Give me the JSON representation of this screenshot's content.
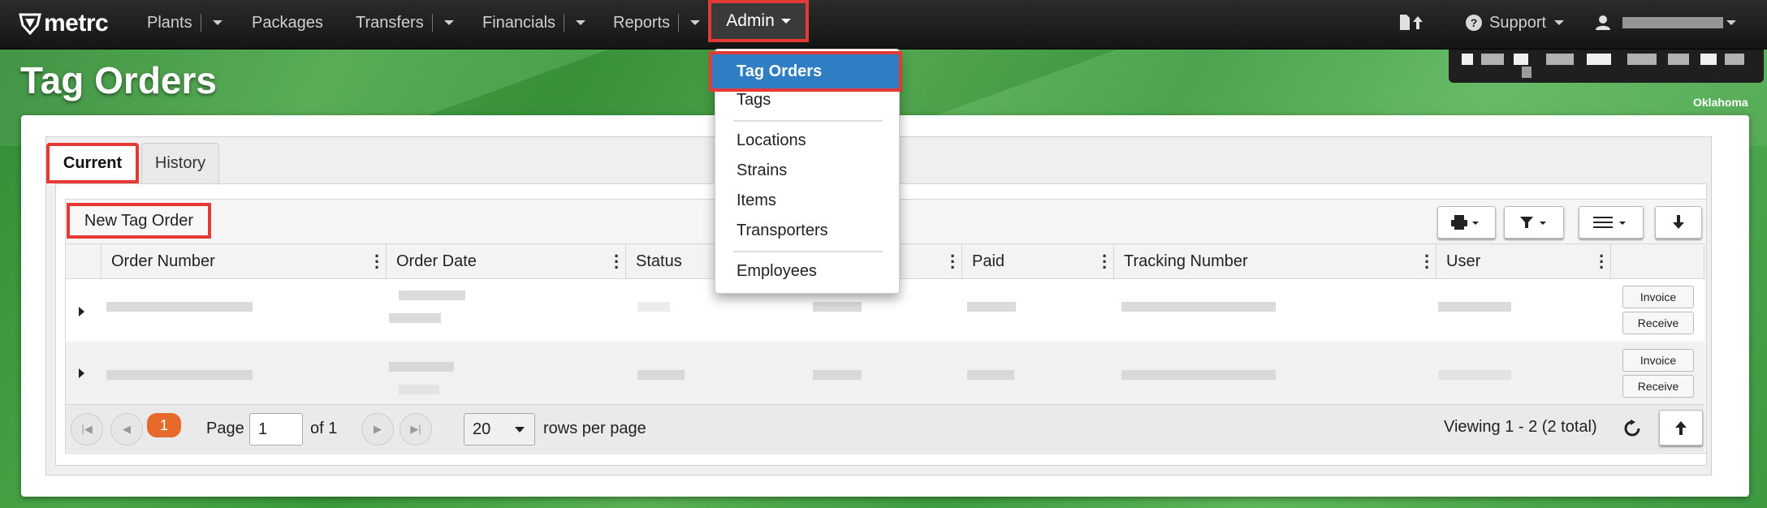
{
  "app": {
    "logo_text": "metrc"
  },
  "nav": {
    "plants": "Plants",
    "packages": "Packages",
    "transfers": "Transfers",
    "financials": "Financials",
    "reports": "Reports",
    "admin": "Admin",
    "support": "Support"
  },
  "header": {
    "title": "Tag Orders",
    "state": "Oklahoma"
  },
  "admin_menu": [
    "Tag Orders",
    "Tags",
    "Locations",
    "Strains",
    "Items",
    "Transporters",
    "Employees"
  ],
  "tabs": [
    "Current",
    "History"
  ],
  "toolbar": {
    "new_tag_order": "New Tag Order"
  },
  "columns": [
    "Order Number",
    "Order Date",
    "Status",
    "Paid",
    "Tracking Number",
    "User"
  ],
  "row_actions": {
    "invoice": "Invoice",
    "receive": "Receive"
  },
  "pager": {
    "current_page_badge": "1",
    "page_label": "Page",
    "page_value": "1",
    "of_label": "of 1",
    "rows_value": "20",
    "rows_label": "rows per page",
    "viewing": "Viewing 1 - 2 (2 total)"
  },
  "colors": {
    "highlight": "#e53935",
    "active_menu": "#2f7ec4",
    "page_badge": "#e86a2a"
  }
}
